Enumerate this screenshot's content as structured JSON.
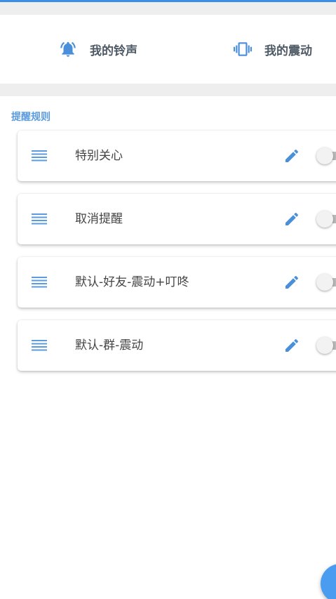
{
  "modes": {
    "ringtone": {
      "label": "我的铃声",
      "icon": "bell-ringing-icon"
    },
    "vibrate": {
      "label": "我的震动",
      "icon": "vibration-icon"
    }
  },
  "rules_section": {
    "title": "提醒规则",
    "rules": [
      {
        "name": "特别关心",
        "enabled": false
      },
      {
        "name": "取消提醒",
        "enabled": false
      },
      {
        "name": "默认-好友-震动+叮咚",
        "enabled": false
      },
      {
        "name": "默认-群-震动",
        "enabled": false
      }
    ]
  },
  "colors": {
    "accent": "#3d8fe6",
    "icon_blue": "#4a8fd9",
    "section_title": "#5b9ce0",
    "text": "#444444",
    "toggle_off_track": "#b9b9b9"
  },
  "fab": {
    "icon": "add-icon"
  }
}
